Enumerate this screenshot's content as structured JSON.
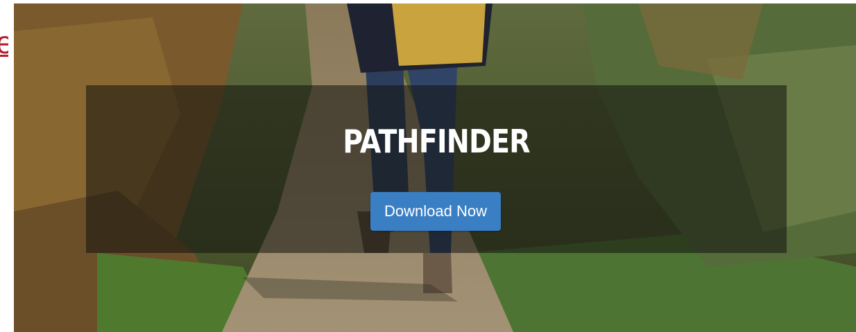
{
  "edge_fragment": "e",
  "hero": {
    "title": "PATHFINDER",
    "cta_label": "Download Now",
    "background_image": "hiker-on-trail-photo"
  },
  "colors": {
    "accent": "#3a7fc4",
    "edge_red": "#b3202a",
    "overlay": "rgba(18,18,14,0.55)"
  }
}
